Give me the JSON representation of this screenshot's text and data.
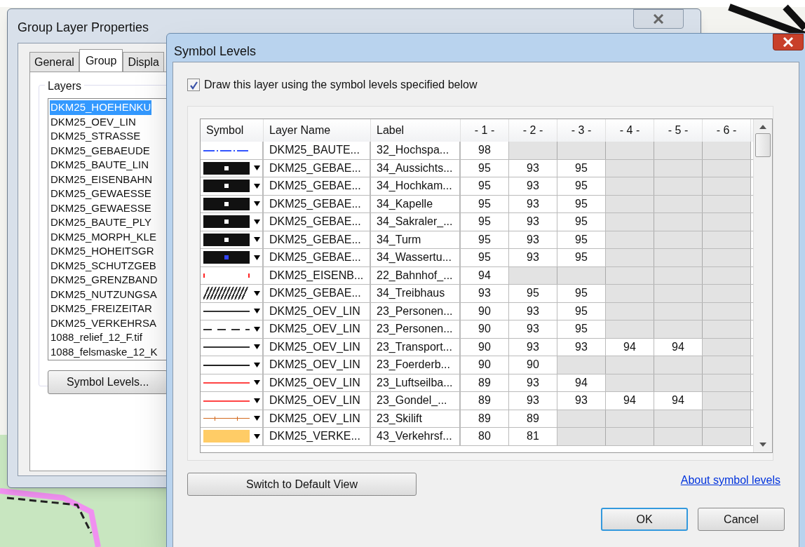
{
  "back_window": {
    "title": "Group Layer Properties",
    "tabs": [
      {
        "label": "General",
        "selected": false
      },
      {
        "label": "Group",
        "selected": true
      },
      {
        "label": "Displa",
        "selected": false
      }
    ],
    "layers_group": {
      "title": "Layers",
      "items": [
        {
          "label": "DKM25_HOEHENKU",
          "selected": true
        },
        {
          "label": "DKM25_OEV_LIN",
          "selected": false
        },
        {
          "label": "DKM25_STRASSE",
          "selected": false
        },
        {
          "label": "DKM25_GEBAEUDE",
          "selected": false
        },
        {
          "label": "DKM25_BAUTE_LIN",
          "selected": false
        },
        {
          "label": "DKM25_EISENBAHN",
          "selected": false
        },
        {
          "label": "DKM25_GEWAESSE",
          "selected": false
        },
        {
          "label": "DKM25_GEWAESSE",
          "selected": false
        },
        {
          "label": "DKM25_BAUTE_PLY",
          "selected": false
        },
        {
          "label": "DKM25_MORPH_KLE",
          "selected": false
        },
        {
          "label": "DKM25_HOHEITSGR",
          "selected": false
        },
        {
          "label": "DKM25_SCHUTZGEB",
          "selected": false
        },
        {
          "label": "DKM25_GRENZBAND",
          "selected": false
        },
        {
          "label": "DKM25_NUTZUNGSA",
          "selected": false
        },
        {
          "label": "DKM25_FREIZEITAR",
          "selected": false
        },
        {
          "label": "DKM25_VERKEHRSA",
          "selected": false
        },
        {
          "label": "1088_relief_12_F.tif",
          "selected": false
        },
        {
          "label": "1088_felsmaske_12_K",
          "selected": false
        }
      ]
    },
    "button": "Symbol Levels..."
  },
  "dialog": {
    "title": "Symbol Levels",
    "checkbox": {
      "label": "Draw this layer using the symbol levels specified below",
      "checked": true
    },
    "table": {
      "columns": [
        "Symbol",
        "Layer Name",
        "Label",
        "- 1 -",
        "- 2 -",
        "- 3 -",
        "- 4 -",
        "- 5 -",
        "- 6 -"
      ],
      "rows": [
        {
          "symbol": {
            "kind": "dash-dot-line",
            "color": "#3355ff"
          },
          "dropdown": false,
          "layer": "DKM25_BAUTE...",
          "label": "32_Hochspa...",
          "levels": [
            "98"
          ]
        },
        {
          "symbol": {
            "kind": "marker-box",
            "color": "#ffffff"
          },
          "dropdown": true,
          "layer": "DKM25_GEBAE...",
          "label": "34_Aussichts...",
          "levels": [
            "95",
            "93",
            "95"
          ]
        },
        {
          "symbol": {
            "kind": "marker-box",
            "color": "#ffffff"
          },
          "dropdown": true,
          "layer": "DKM25_GEBAE...",
          "label": "34_Hochkam...",
          "levels": [
            "95",
            "93",
            "95"
          ]
        },
        {
          "symbol": {
            "kind": "marker-box",
            "color": "#ffffff"
          },
          "dropdown": true,
          "layer": "DKM25_GEBAE...",
          "label": "34_Kapelle",
          "levels": [
            "95",
            "93",
            "95"
          ]
        },
        {
          "symbol": {
            "kind": "marker-box",
            "color": "#ffffff"
          },
          "dropdown": true,
          "layer": "DKM25_GEBAE...",
          "label": "34_Sakraler_...",
          "levels": [
            "95",
            "93",
            "95"
          ]
        },
        {
          "symbol": {
            "kind": "marker-box",
            "color": "#ffffff"
          },
          "dropdown": true,
          "layer": "DKM25_GEBAE...",
          "label": "34_Turm",
          "levels": [
            "95",
            "93",
            "95"
          ]
        },
        {
          "symbol": {
            "kind": "marker-box",
            "color": "#3344ff"
          },
          "dropdown": true,
          "layer": "DKM25_GEBAE...",
          "label": "34_Wassertu...",
          "levels": [
            "95",
            "93",
            "95"
          ]
        },
        {
          "symbol": {
            "kind": "tick-marks",
            "color": "#ff2222"
          },
          "dropdown": false,
          "layer": "DKM25_EISENB...",
          "label": "22_Bahnhof_...",
          "levels": [
            "94"
          ]
        },
        {
          "symbol": {
            "kind": "hatch",
            "color": "#333333"
          },
          "dropdown": true,
          "layer": "DKM25_GEBAE...",
          "label": "34_Treibhaus",
          "levels": [
            "93",
            "95",
            "95"
          ]
        },
        {
          "symbol": {
            "kind": "line",
            "color": "#333333"
          },
          "dropdown": true,
          "layer": "DKM25_OEV_LIN",
          "label": "23_Personen...",
          "levels": [
            "90",
            "93",
            "95"
          ]
        },
        {
          "symbol": {
            "kind": "dashed-line",
            "color": "#333333"
          },
          "dropdown": true,
          "layer": "DKM25_OEV_LIN",
          "label": "23_Personen...",
          "levels": [
            "90",
            "93",
            "95"
          ]
        },
        {
          "symbol": {
            "kind": "line",
            "color": "#333333"
          },
          "dropdown": true,
          "layer": "DKM25_OEV_LIN",
          "label": "23_Transport...",
          "levels": [
            "90",
            "93",
            "93",
            "94",
            "94"
          ]
        },
        {
          "symbol": {
            "kind": "line",
            "color": "#222222"
          },
          "dropdown": true,
          "layer": "DKM25_OEV_LIN",
          "label": "23_Foerderb...",
          "levels": [
            "90",
            "90"
          ]
        },
        {
          "symbol": {
            "kind": "line",
            "color": "#ff4444"
          },
          "dropdown": true,
          "layer": "DKM25_OEV_LIN",
          "label": "23_Luftseilba...",
          "levels": [
            "89",
            "93",
            "94"
          ]
        },
        {
          "symbol": {
            "kind": "line",
            "color": "#ff4444"
          },
          "dropdown": true,
          "layer": "DKM25_OEV_LIN",
          "label": "23_Gondel_...",
          "levels": [
            "89",
            "93",
            "93",
            "94",
            "94"
          ]
        },
        {
          "symbol": {
            "kind": "tick-line",
            "color": "#d2691e"
          },
          "dropdown": true,
          "layer": "DKM25_OEV_LIN",
          "label": "23_Skilift",
          "levels": [
            "89",
            "89"
          ]
        },
        {
          "symbol": {
            "kind": "fill",
            "color": "#ffcc66"
          },
          "dropdown": true,
          "layer": "DKM25_VERKE...",
          "label": "43_Verkehrsf...",
          "levels": [
            "80",
            "81"
          ]
        }
      ]
    },
    "switch_button": "Switch to Default View",
    "link": "About symbol levels",
    "ok": "OK",
    "cancel": "Cancel"
  }
}
